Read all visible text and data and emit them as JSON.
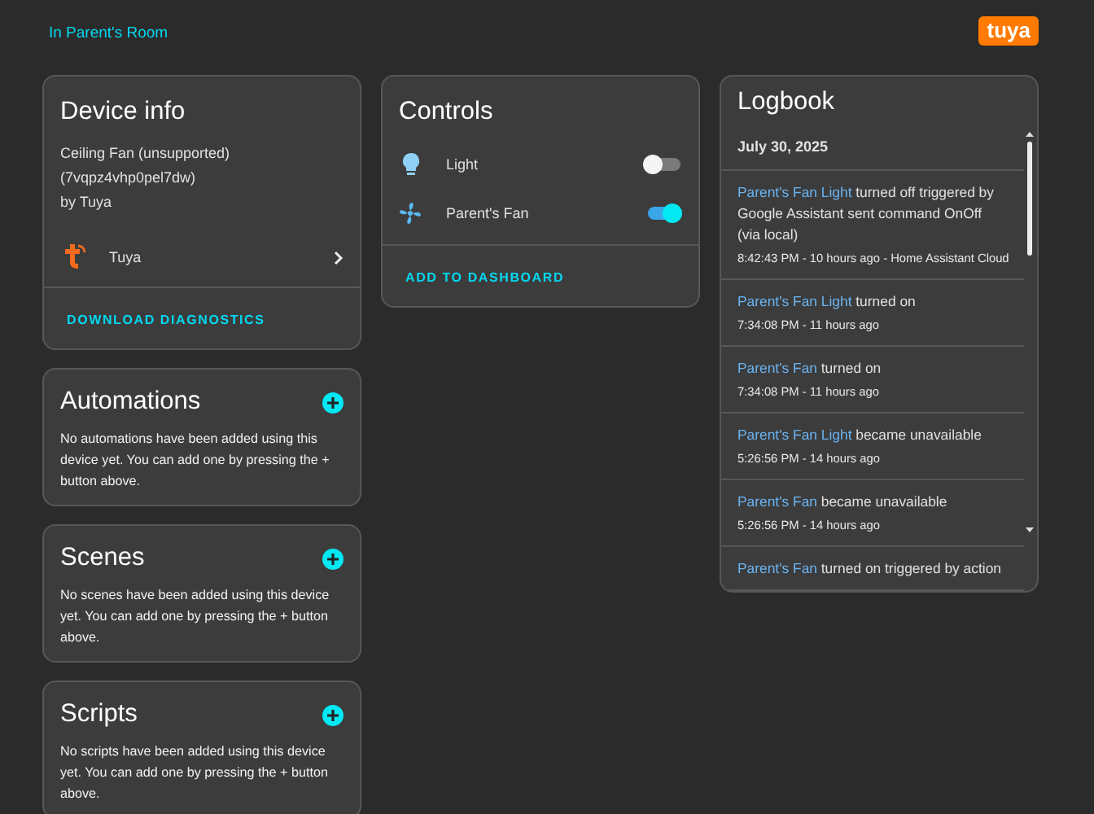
{
  "breadcrumb": "In Parent's Room",
  "logo": "tuya",
  "device_info": {
    "title": "Device info",
    "model": "Ceiling Fan (unsupported)",
    "model_id": "(7vqpz4vhp0pel7dw)",
    "manufacturer": "by Tuya",
    "integration": "Tuya",
    "action": "DOWNLOAD DIAGNOSTICS"
  },
  "sections": [
    {
      "title": "Automations",
      "text": "No automations have been added using this device yet. You can add one by pressing the + button above."
    },
    {
      "title": "Scenes",
      "text": "No scenes have been added using this device yet. You can add one by pressing the + button above."
    },
    {
      "title": "Scripts",
      "text": "No scripts have been added using this device yet. You can add one by pressing the + button above."
    }
  ],
  "controls": {
    "title": "Controls",
    "items": [
      {
        "kind": "light",
        "name": "Light",
        "on": false
      },
      {
        "kind": "fan",
        "name": "Parent's Fan",
        "on": true
      }
    ],
    "action": "ADD TO DASHBOARD"
  },
  "logbook": {
    "title": "Logbook",
    "date": "July 30, 2025",
    "entries": [
      {
        "entity": "Parent's Fan Light",
        "message": "turned off triggered by Google Assistant sent command OnOff (via local)",
        "time": "8:42:43 PM - 10 hours ago - Home Assistant Cloud"
      },
      {
        "entity": "Parent's Fan Light",
        "message": "turned on",
        "time": "7:34:08 PM - 11 hours ago"
      },
      {
        "entity": "Parent's Fan",
        "message": "turned on",
        "time": "7:34:08 PM - 11 hours ago"
      },
      {
        "entity": "Parent's Fan Light",
        "message": "became unavailable",
        "time": "5:26:56 PM - 14 hours ago"
      },
      {
        "entity": "Parent's Fan",
        "message": "became unavailable",
        "time": "5:26:56 PM - 14 hours ago"
      },
      {
        "entity": "Parent's Fan",
        "message": "turned on triggered by action"
      }
    ]
  }
}
